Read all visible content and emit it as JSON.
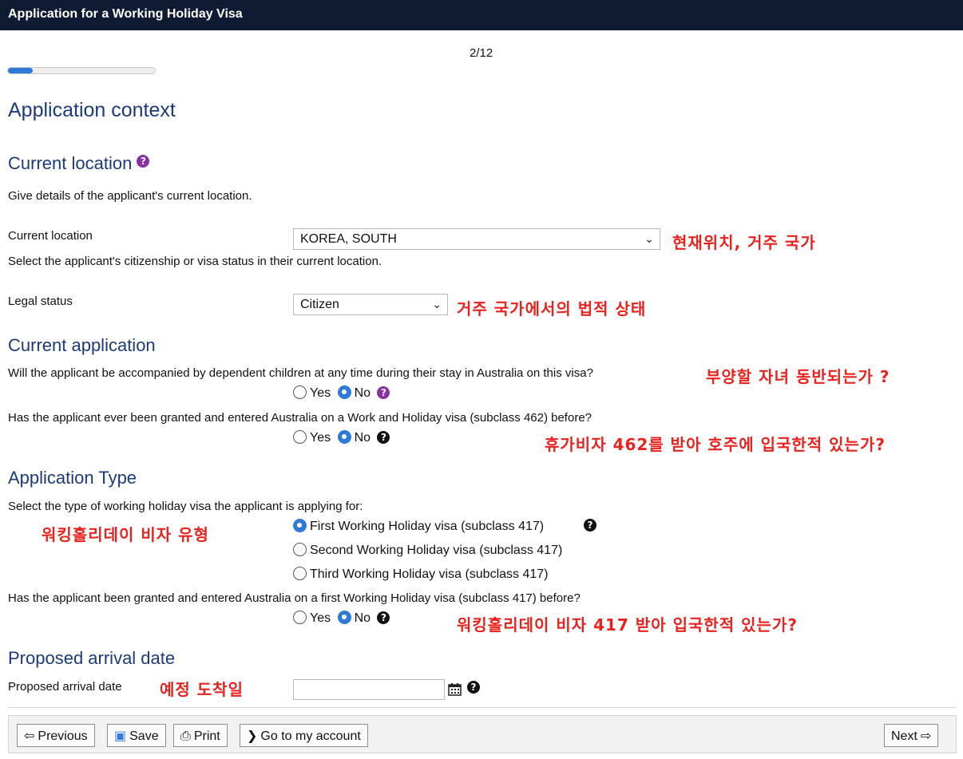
{
  "window": {
    "title": "Application for a Working Holiday Visa"
  },
  "progress": {
    "label": "2/12",
    "fraction": 0.167
  },
  "page": {
    "heading": "Application context"
  },
  "current_location_section": {
    "heading": "Current location",
    "intro": "Give details of the applicant's current location.",
    "location_label": "Current location",
    "location_value": "KOREA, SOUTH",
    "location_note": "Select the applicant's citizenship or visa status in their current location.",
    "legal_status_label": "Legal status",
    "legal_status_value": "Citizen"
  },
  "current_application": {
    "heading": "Current application",
    "q1": "Will the applicant be accompanied by dependent children at any time during their stay in Australia on this visa?",
    "q2": "Has the applicant ever been granted and entered Australia on a Work and Holiday visa (subclass 462) before?",
    "yes": "Yes",
    "no": "No"
  },
  "application_type": {
    "heading": "Application Type",
    "prompt": "Select the type of working holiday visa the applicant is applying for:",
    "options": [
      "First Working Holiday visa (subclass 417)",
      "Second Working Holiday visa (subclass 417)",
      "Third Working Holiday visa (subclass 417)"
    ],
    "selected": 0,
    "q3": "Has the applicant been granted and entered Australia on a first Working Holiday visa (subclass 417) before?"
  },
  "arrival": {
    "heading": "Proposed arrival date",
    "label": "Proposed arrival date",
    "value": ""
  },
  "annotations": {
    "location": "현재위치, 거주 국가",
    "legal_status": "거주 국가에서의 법적 상태",
    "children": "부양할 자녀 동반되는가 ?",
    "visa462": "휴가비자 462를 받아 호주에 입국한적 있는가?",
    "visa_type": "워킹홀리데이 비자 유형",
    "visa417": "워킹홀리데이 비자 417 받아 입국한적 있는가?",
    "arrival": "예정 도착일"
  },
  "buttons": {
    "previous": "Previous",
    "save": "Save",
    "print": "Print",
    "account": "Go to my account",
    "next": "Next"
  },
  "icons": {
    "help": "help-icon",
    "calendar": "calendar-icon",
    "previous": "arrow-left-icon",
    "save": "floppy-disk-icon",
    "print": "printer-icon",
    "account": "chevron-right-icon",
    "next": "arrow-right-icon"
  },
  "colors": {
    "header": "#0f1b33",
    "heading": "#1d3a7a",
    "accent": "#2f7ad6",
    "annotation": "#e8231f",
    "help_purple": "#8b2fa8"
  }
}
